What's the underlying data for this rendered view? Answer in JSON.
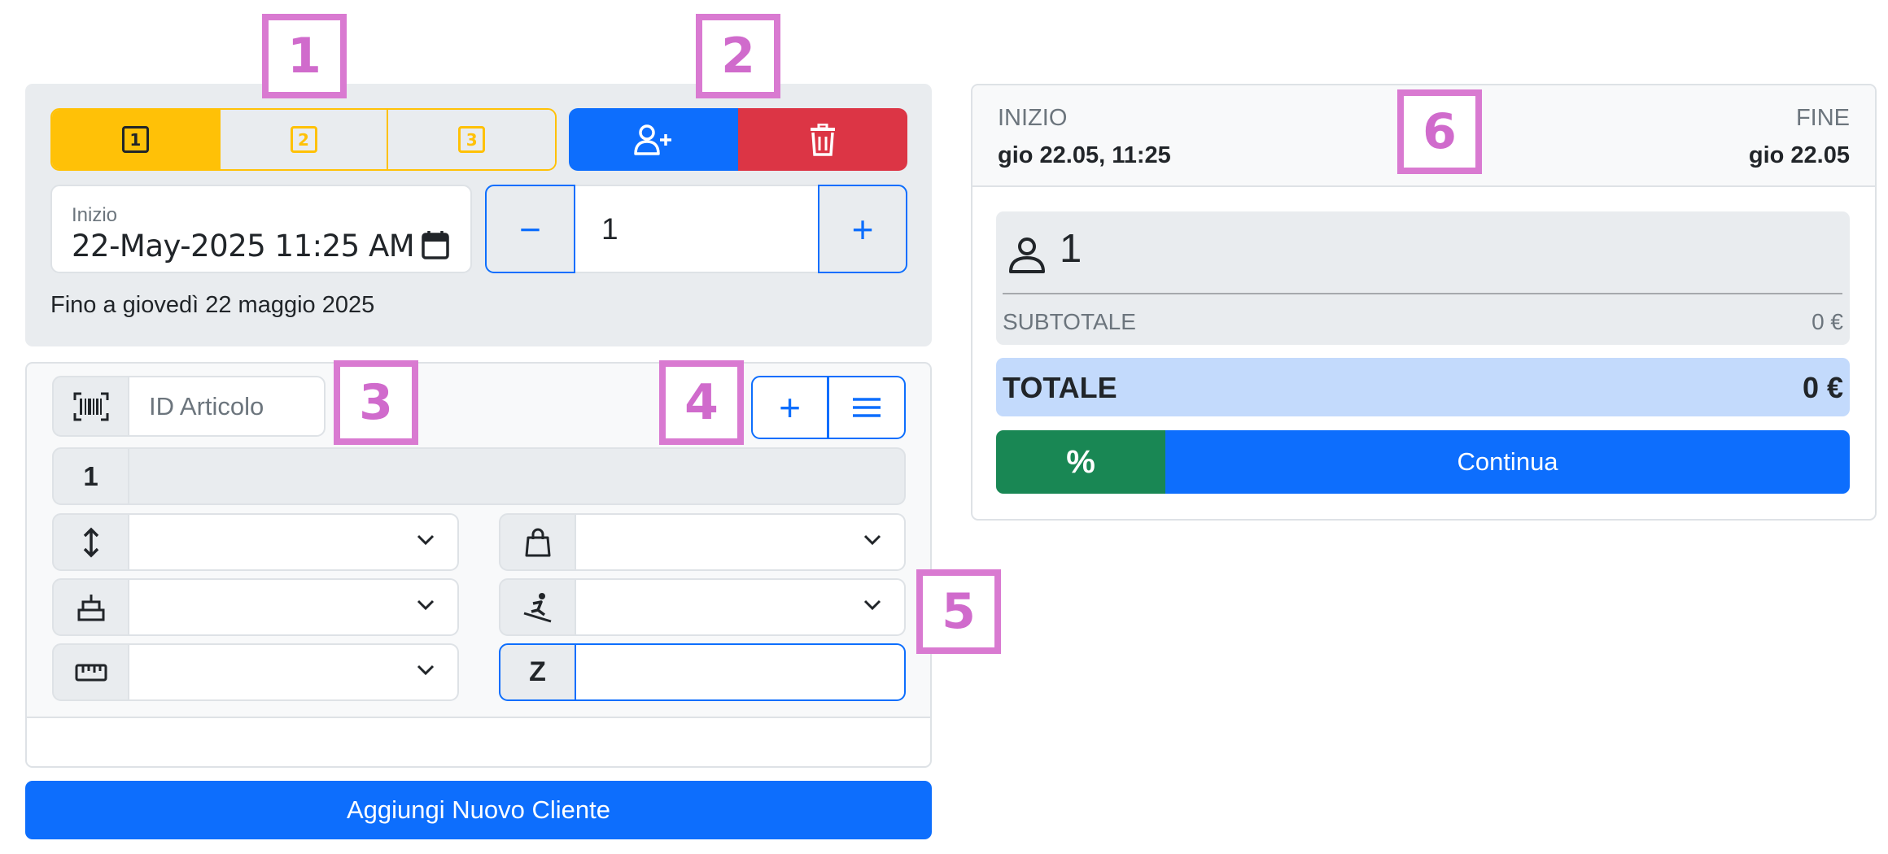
{
  "markers": {
    "m1": "1",
    "m2": "2",
    "m3": "3",
    "m4": "4",
    "m5": "5",
    "m6": "6"
  },
  "steps": [
    {
      "label": "1"
    },
    {
      "label": "2"
    },
    {
      "label": "3"
    }
  ],
  "icons": {
    "add_user": "person-plus-icon",
    "delete": "trash-icon",
    "calendar": "calendar-icon",
    "barcode": "barcode-icon",
    "list": "list-icon",
    "height": "arrows-vertical-icon",
    "shoe": "shopping-bag-icon",
    "age": "cake-icon",
    "skier": "skier-icon",
    "ruler": "ruler-icon",
    "person": "person-icon"
  },
  "start_field": {
    "label": "Inizio",
    "value": "22-May-2025 11:25  AM"
  },
  "quantity": {
    "minus": "−",
    "value": "1",
    "plus": "+"
  },
  "until_text": "Fino a giovedì 22 maggio 2025",
  "article": {
    "placeholder": "ID Articolo",
    "add": "+",
    "index": "1",
    "z_label": "Z"
  },
  "new_client_button": "Aggiungi Nuovo Cliente",
  "summary": {
    "start_label": "INIZIO",
    "start_value": "gio 22.05, 11:25",
    "end_label": "FINE",
    "end_value": "gio 22.05",
    "clients": "1",
    "subtotal_label": "SUBTOTALE",
    "subtotal_value": "0 €",
    "total_label": "TOTALE",
    "total_value": "0 €",
    "discount": "%",
    "continue": "Continua"
  },
  "colors": {
    "primary": "#0d6efd",
    "danger": "#dc3545",
    "warning": "#ffc107",
    "success": "#198754",
    "marker": "#d97ad1"
  }
}
